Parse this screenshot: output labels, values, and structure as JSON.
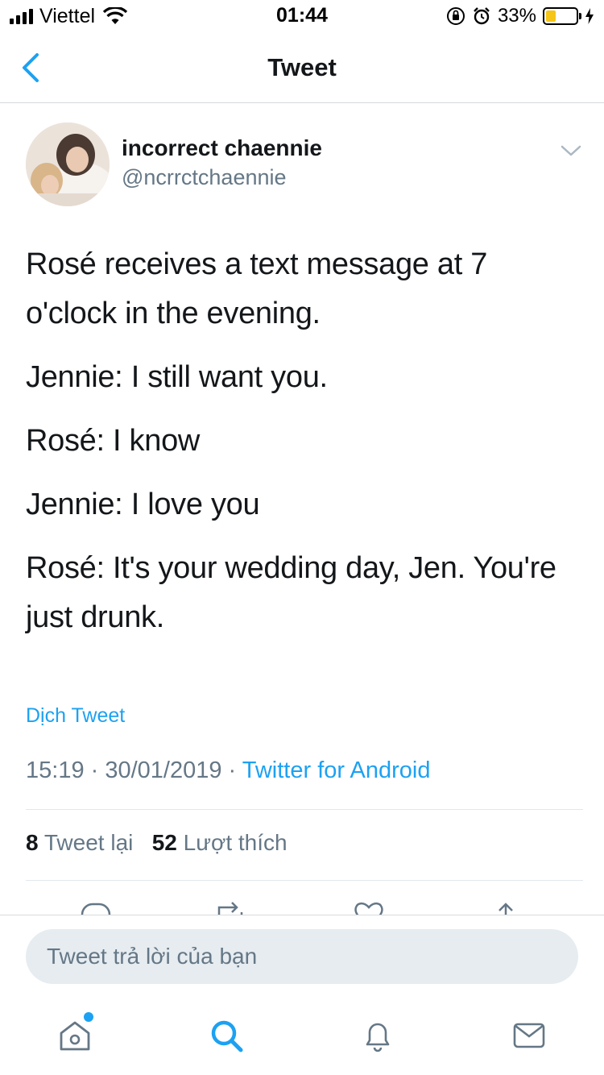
{
  "status_bar": {
    "carrier": "Viettel",
    "time": "01:44",
    "battery_percent": "33%",
    "battery_level": 0.33,
    "battery_color": "#f5c518"
  },
  "nav": {
    "title": "Tweet",
    "back_icon": "chevron-left-icon"
  },
  "tweet": {
    "author_name": "incorrect chaennie",
    "author_handle": "@ncrrctchaennie",
    "paragraphs": [
      "Rosé receives a text message at 7 o'clock in the evening.",
      "Jennie: I still want you.",
      "Rosé: I know",
      "Jennie: I love you",
      "Rosé: It's your wedding day, Jen. You're just drunk."
    ],
    "translate_label": "Dịch Tweet",
    "timestamp": "15:19 · 30/01/2019 · ",
    "source": "Twitter for Android",
    "retweet_count": "8",
    "retweet_label": "Tweet lại",
    "like_count": "52",
    "like_label": "Lượt thích"
  },
  "reply": {
    "placeholder": "Tweet trả lời của bạn"
  },
  "tabbar": {
    "items": [
      "home-icon",
      "search-icon",
      "notifications-icon",
      "messages-icon"
    ]
  },
  "colors": {
    "accent": "#1da1f2",
    "secondary_text": "#657786",
    "primary_text": "#14171a"
  }
}
